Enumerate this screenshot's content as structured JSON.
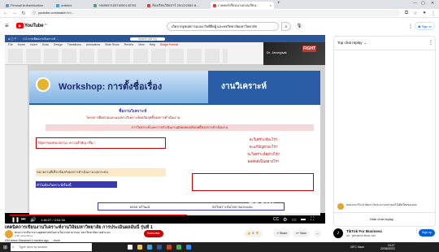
{
  "browser": {
    "tabs": [
      {
        "label": "Firewall Authentication",
        "color": "#6b8ec7"
      },
      {
        "label": "untitled",
        "color": "#4a9ad6"
      },
      {
        "label": "+66985716576950145781",
        "color": "#4aa36c"
      },
      {
        "label": "ห้องเรียนวิจัยสาร์ 25/12/2565 ห...",
        "color": "#e03a3a"
      },
      {
        "label": "เวลเคอร์เรียนนวนกอนเรียน... ",
        "color": "#e03a3a"
      }
    ],
    "url": "youtube.com/watch?v=..."
  },
  "youtube": {
    "search_value": "เกิดจากฐษ่อยการแถลง กิจที่อืดผู้ และคชวิทยาลัยมหาวิทยาลัย",
    "sign_in": "Sign in",
    "logo_label": "YouTube",
    "logo_suffix": "TH",
    "chat_header": "Top chat replay",
    "chat_message": "ค่อนอามารีจะท่าผิดงร เกิดจะบ่งามเขาของไม้เต็ทใหดขอบคุณ",
    "hide_chat": "Hide chat replay",
    "video_title": "เทคนิคการเขียนงานวิเคราะห์งานวิจัยมหาวิทยาลัย การประเมินผลอันนี้ รุ่นที่ 1",
    "channel": "คณะการบริหารงานยุทธศาสตร์และนโยบายสาธารณะ มหาวิทยาลัยรามคำแหง",
    "subscribers": "2.3K subscribers",
    "subscribe": "Subscribe",
    "likes": "9",
    "share": "Share",
    "save": "Save",
    "views": "234 views Streamed 4 months ago",
    "more": "...more",
    "ad_title": "TikTok For Business",
    "ad_sub": "Ad · getstarted.tiktok.com",
    "ad_button": "Sign up",
    "time": "1:46:07 / 3:04:34"
  },
  "slide": {
    "title": "Workshop: การตั้งชื่อเรื่อง",
    "title_right": "งานวิเคราะห์",
    "sub1": "ชื่องานวิเคราะห์",
    "sub2": "โครงการติดตามและแนวทางวิเคราะห์ผลสัมฤทธิ์ของการดำเนินงาน",
    "band": "การวิเคราะห์ และการดำเนินงานสุดยอดผลสัมฤทธิ์ของการดำเนินงาน",
    "box1": "ปัญหาของหน่วยงาน / ความสำคัญ / ที่มา",
    "box2": "หน่วยงานที่เกี่ยวข้องกับผลการดำเนินงาน ผลกระทบ",
    "box3": "ทำไมต้องวิเคราะห์เรื่องนี้",
    "q1": "จะวิเคราะห์อะไร?",
    "q2": "จะแก้ปัญหาอะไร?",
    "q3": "จะวิเคราะห์อย่างไร?",
    "q4": "ผลลัพธ์เป็นอย่างไร?",
    "footer_left": "หลอด อภิวัฒน์",
    "footer_mid": "นักวิเคราะห์นโยบายและแผน",
    "presenter": "Dr. Jarongsak"
  },
  "ppt": {
    "tabs": [
      "File",
      "Home",
      "Insert",
      "Draw",
      "Design",
      "Transitions",
      "Animations",
      "Slide Show",
      "Review",
      "View",
      "Help",
      "Shape Format"
    ],
    "filename": "ก.2 การเขียนงานวิเคราะห์ ...",
    "search_placeholder": "Search (Alt+Q)"
  },
  "taskbar": {
    "search": "Type here to search",
    "weather": "28°C Haze",
    "time": "15:27",
    "date": "22/08/2023"
  }
}
